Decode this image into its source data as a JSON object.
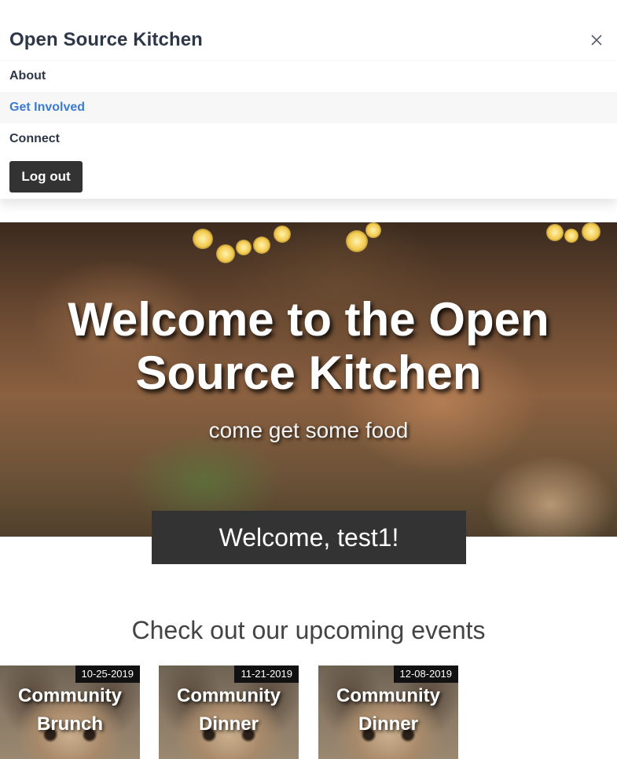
{
  "nav": {
    "brand": "Open Source Kitchen",
    "close_icon": "close-icon",
    "items": [
      {
        "label": "About",
        "active": false
      },
      {
        "label": "Get Involved",
        "active": true
      },
      {
        "label": "Connect",
        "active": false
      }
    ],
    "logout_label": "Log out",
    "active_color": "#3b7bd4"
  },
  "hero": {
    "title": "Welcome to the Open Source Kitchen",
    "subtitle": "come get some food"
  },
  "welcome": {
    "text": "Welcome, test1!",
    "background": "#333333"
  },
  "events": {
    "heading": "Check out our upcoming events",
    "cards": [
      {
        "date": "10-25-2019",
        "title": "Community Brunch"
      },
      {
        "date": "11-21-2019",
        "title": "Community Dinner"
      },
      {
        "date": "12-08-2019",
        "title": "Community Dinner"
      }
    ]
  }
}
